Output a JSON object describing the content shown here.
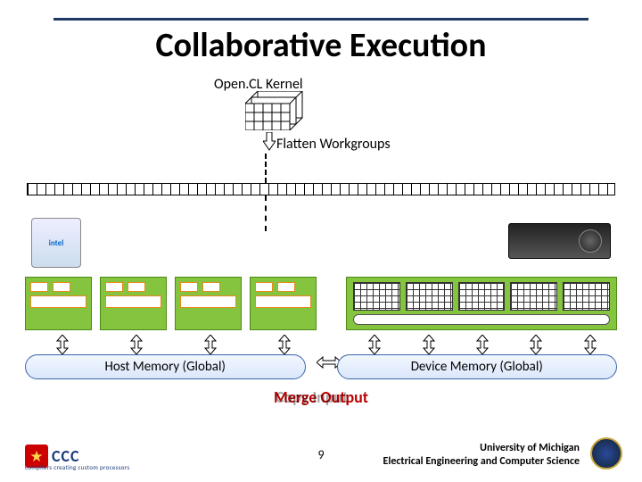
{
  "title": "Collaborative Execution",
  "kernel_label": "Open.CL Kernel",
  "flatten_label": "Flatten Workgroups",
  "host_memory": "Host Memory (Global)",
  "device_memory": "Device Memory (Global)",
  "merge_output": "Merge Output",
  "copy_input_shadow": "Copy Input",
  "page_number": "9",
  "affiliation_line1": "University of Michigan",
  "affiliation_line2": "Electrical Engineering and Computer Science",
  "ccc_logo_text": "CCC",
  "ccc_logo_sub": "compilers creating custom processors",
  "cpu_vendor_hint": "intel",
  "icons": {
    "down_arrow": "down-arrow-icon",
    "bi_arrow": "bi-arrow-icon",
    "cpu": "cpu-chip-icon",
    "gpu": "gpu-card-icon",
    "seal": "university-seal-icon"
  }
}
